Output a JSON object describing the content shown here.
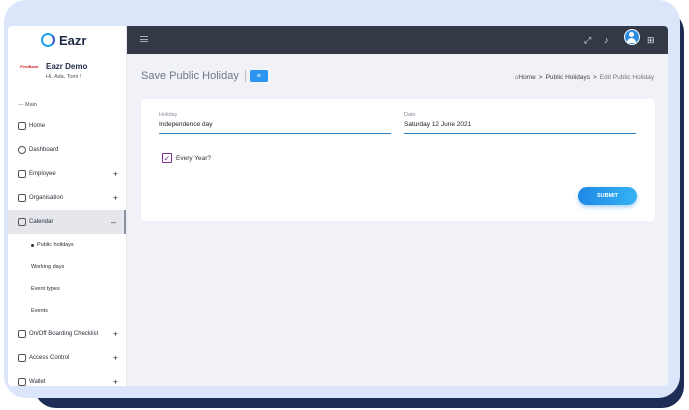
{
  "app": {
    "name": "Eazr"
  },
  "user": {
    "company_logo": "FirstBank",
    "company": "Eazr Demo",
    "greeting": "Hi, Ada, Tomi !"
  },
  "sidebar": {
    "section": "--- Main",
    "items": [
      {
        "label": "Home",
        "icon": "home-icon"
      },
      {
        "label": "Dashboard",
        "icon": "dashboard-icon"
      },
      {
        "label": "Employee",
        "icon": "employee-icon",
        "expander": "+"
      },
      {
        "label": "Organisation",
        "icon": "organisation-icon",
        "expander": "+"
      },
      {
        "label": "Calendar",
        "icon": "calendar-icon",
        "expander": "–"
      }
    ],
    "calendar_subitems": [
      "Public holidays",
      "Working days",
      "Event types",
      "Events"
    ],
    "more_items": [
      {
        "label": "On/Off Boarding Checklist",
        "icon": "checklist-icon",
        "expander": "+"
      },
      {
        "label": "Access Control",
        "icon": "lock-icon",
        "expander": "+"
      },
      {
        "label": "Wallet",
        "icon": "wallet-icon",
        "expander": "+"
      }
    ]
  },
  "topbar": {
    "icons": [
      "menu-icon",
      "fullscreen-icon",
      "bell-icon",
      "avatar",
      "apps-grid-icon"
    ]
  },
  "page": {
    "title": "Save Public Holiday",
    "list_button_icon": "≡"
  },
  "breadcrumb": {
    "home": "Home",
    "sep": ">",
    "section": "Public Holidays",
    "current": "Edit Public Holiday"
  },
  "form": {
    "holiday_label": "Holiday",
    "holiday_value": "Independence day",
    "date_label": "Date",
    "date_value": "Saturday 12 June 2021",
    "every_year_label": "Every Year?",
    "every_year_checked": true,
    "submit_label": "SUBMIT"
  },
  "colors": {
    "accent": "#2b95f2",
    "topbar": "#333a46",
    "checkbox": "#7c2f8e"
  }
}
